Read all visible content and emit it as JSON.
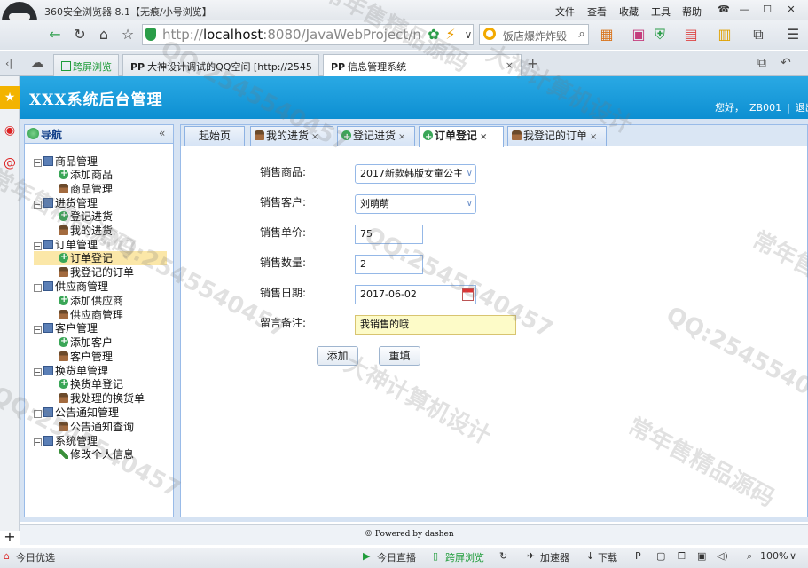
{
  "browser": {
    "title": "360安全浏览器 8.1【无痕/小号浏览】",
    "menu": [
      "文件",
      "查看",
      "收藏",
      "工具",
      "帮助"
    ],
    "url_prefix": "http://",
    "url_host": "localhost",
    "url_rest": ":8080/JavaWebProject/main.js",
    "search_placeholder": "饭店爆炸炸毁",
    "tabs": [
      {
        "label": "跨屏浏览"
      },
      {
        "label": "大神设计调试的QQ空间 [http://2545"
      },
      {
        "label": "信息管理系统"
      }
    ]
  },
  "app": {
    "title": "XXX系统后台管理",
    "greeting": "您好，",
    "username": "ZB001",
    "separator": "|",
    "logout": "退出"
  },
  "nav": {
    "title": "导航",
    "collapse": "«",
    "tree": [
      {
        "label": "商品管理",
        "type": "group"
      },
      {
        "label": "添加商品",
        "type": "add"
      },
      {
        "label": "商品管理",
        "type": "user"
      },
      {
        "label": "进货管理",
        "type": "group"
      },
      {
        "label": "登记进货",
        "type": "add"
      },
      {
        "label": "我的进货",
        "type": "user"
      },
      {
        "label": "订单管理",
        "type": "group"
      },
      {
        "label": "订单登记",
        "type": "add"
      },
      {
        "label": "我登记的订单",
        "type": "user"
      },
      {
        "label": "供应商管理",
        "type": "group"
      },
      {
        "label": "添加供应商",
        "type": "add"
      },
      {
        "label": "供应商管理",
        "type": "user"
      },
      {
        "label": "客户管理",
        "type": "group"
      },
      {
        "label": "添加客户",
        "type": "add"
      },
      {
        "label": "客户管理",
        "type": "user"
      },
      {
        "label": "换货单管理",
        "type": "group"
      },
      {
        "label": "换货单登记",
        "type": "add"
      },
      {
        "label": "我处理的换货单",
        "type": "user"
      },
      {
        "label": "公告通知管理",
        "type": "group"
      },
      {
        "label": "公告通知查询",
        "type": "user"
      },
      {
        "label": "系统管理",
        "type": "group"
      },
      {
        "label": "修改个人信息",
        "type": "pen"
      }
    ]
  },
  "tabs": [
    {
      "label": "起始页"
    },
    {
      "label": "我的进货"
    },
    {
      "label": "登记进货"
    },
    {
      "label": "订单登记"
    },
    {
      "label": "我登记的订单"
    }
  ],
  "form": {
    "product_label": "销售商品:",
    "product_value": "2017新款韩版女童公主",
    "customer_label": "销售客户:",
    "customer_value": "刘萌萌",
    "price_label": "销售单价:",
    "price_value": "75",
    "quantity_label": "销售数量:",
    "quantity_value": "2",
    "date_label": "销售日期:",
    "date_value": "2017-06-02",
    "note_label": "留言备注:",
    "note_value": "我销售的哦",
    "add_button": "添加",
    "reset_button": "重填"
  },
  "footer": {
    "text": "© Powered by dashen"
  },
  "status": {
    "left": "今日优选",
    "live": "今日直播",
    "cross": "跨屏浏览",
    "accelerator": "加速器",
    "download": "下载",
    "zoom": "100%"
  },
  "watermarks": [
    "常年售精品源码",
    "QQ:2545540457",
    "大神计算机设计"
  ]
}
